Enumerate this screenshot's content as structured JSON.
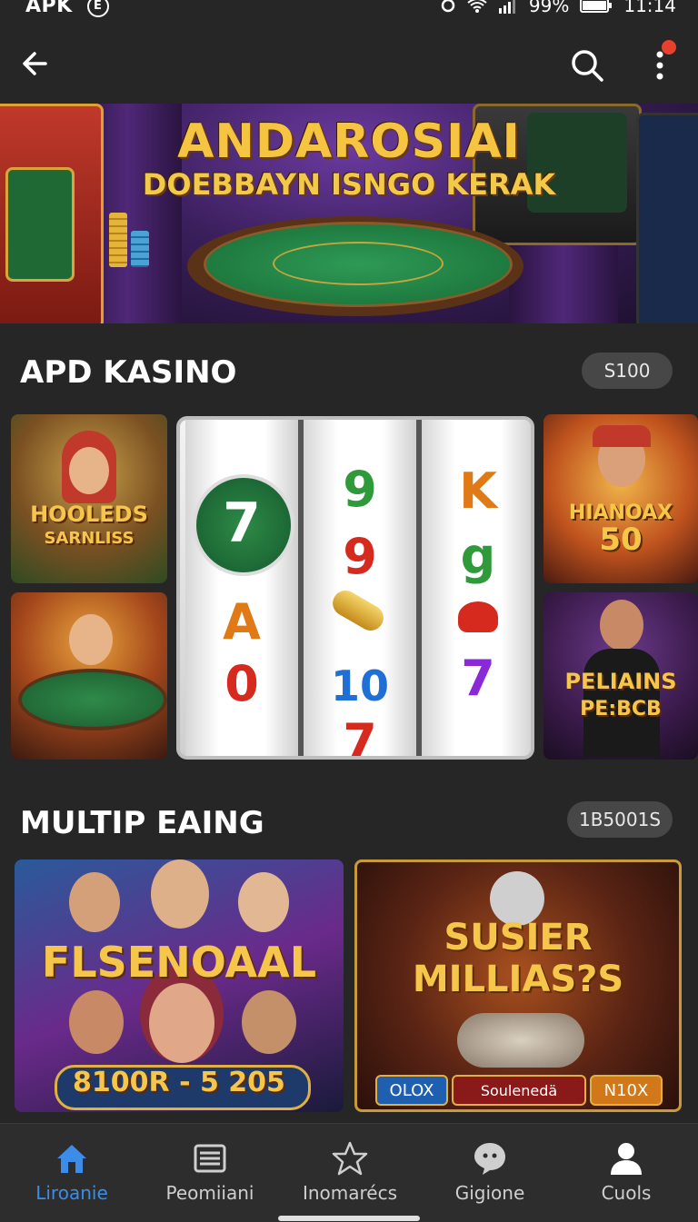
{
  "status_bar": {
    "app_label": "APK",
    "badge": "E",
    "battery": "99%",
    "time": "11:14"
  },
  "app_bar": {
    "back_icon": "arrow-left-icon",
    "search_icon": "search-icon",
    "more_icon": "more-vertical-icon"
  },
  "banner": {
    "title": "ANDAROSIAI",
    "subtitle": "DOEBBAYN ISNGO KERAK"
  },
  "section_casino": {
    "title": "APD KASINO",
    "pill": "S100",
    "tiles": [
      {
        "label_line1": "HOOLEDS",
        "label_line2": "SARNLISS"
      },
      {
        "label_line1": "HIANOAX",
        "label_line2": "50"
      },
      {
        "label_line1": "PELIAINS",
        "label_line2": "PE:BCB"
      }
    ],
    "reels": [
      [
        "7",
        "A",
        "0"
      ],
      [
        "9",
        "9",
        "10",
        "7"
      ],
      [
        "K",
        "g",
        "7"
      ]
    ]
  },
  "section_multi": {
    "title": "MULTIP EAING",
    "pill": "1B5001S",
    "cards": [
      {
        "title": "FLSENOAAL",
        "sub": "8100R - 5 205"
      },
      {
        "title_line1": "SUSIER",
        "title_line2": "MILLIAS?S",
        "btn_left": "OLOX",
        "btn_center": "Soulenedä",
        "btn_right": "N10X"
      }
    ]
  },
  "bottom_nav": [
    {
      "label": "Liroanie",
      "icon": "home-icon",
      "active": true
    },
    {
      "label": "Peomiiani",
      "icon": "list-icon",
      "active": false
    },
    {
      "label": "Inomarécs",
      "icon": "star-icon",
      "active": false
    },
    {
      "label": "Gigione",
      "icon": "chat-icon",
      "active": false
    },
    {
      "label": "Cuols",
      "icon": "profile-icon",
      "active": false
    }
  ],
  "colors": {
    "background": "#262626",
    "accent": "#3b8de8",
    "gold": "#f5c542"
  }
}
